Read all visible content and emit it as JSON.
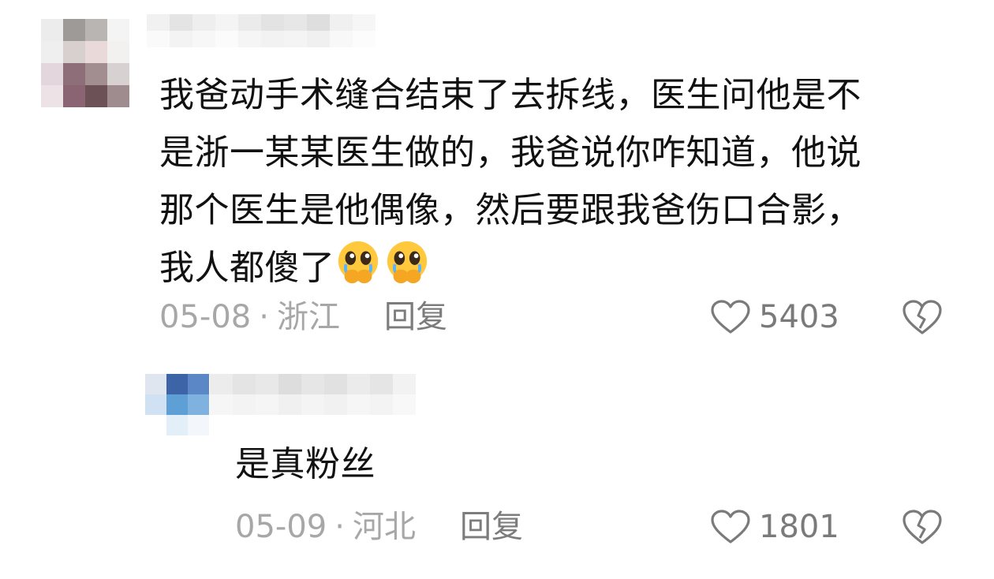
{
  "comment": {
    "text_lines": [
      "我爸动手术缝合结束了去拆线，医生问他是不",
      "是浙一某某医生做的，我爸说你咋知道，他说",
      "那个医生是他偶像，然后要跟我爸伤口合影，",
      "我人都傻了"
    ],
    "emojis": [
      "pleading-face-emoji",
      "pleading-face-emoji"
    ],
    "date": "05-08",
    "separator": "·",
    "location": "浙江",
    "reply_label": "回复",
    "likes": "5403"
  },
  "reply": {
    "text": "是真粉丝",
    "date": "05-09",
    "separator": "·",
    "location": "河北",
    "reply_label": "回复",
    "likes": "1801"
  },
  "colors": {
    "meta": "#a7a7a7",
    "icon": "#7a7a7a",
    "text": "#111111"
  }
}
